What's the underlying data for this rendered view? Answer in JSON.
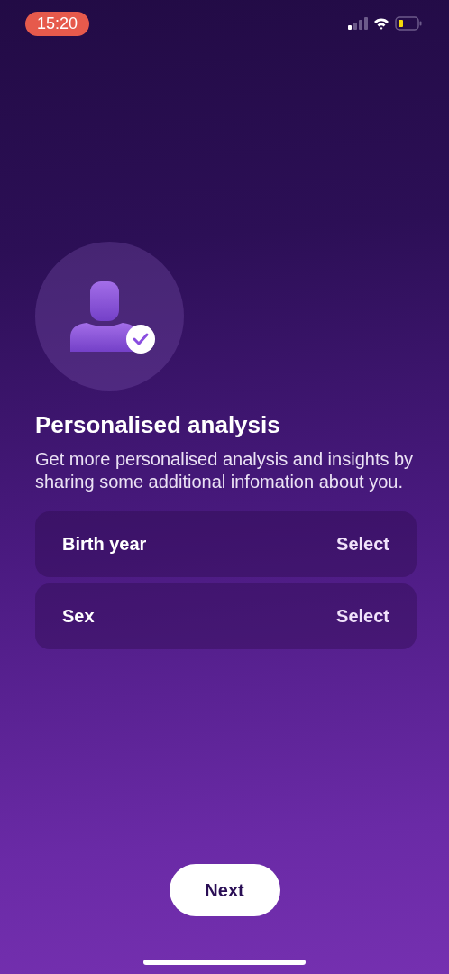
{
  "status_bar": {
    "time": "15:20"
  },
  "title": "Personalised analysis",
  "description": "Get more personalised analysis and insights by sharing some additional infomation about you.",
  "fields": [
    {
      "label": "Birth year",
      "value": "Select"
    },
    {
      "label": "Sex",
      "value": "Select"
    }
  ],
  "next_button": "Next"
}
